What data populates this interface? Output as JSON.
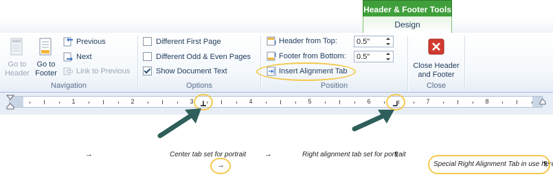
{
  "contextual_tab": {
    "title": "Header & Footer Tools",
    "tab": "Design"
  },
  "navigation": {
    "label": "Navigation",
    "go_to_header": [
      "Go to",
      "Header"
    ],
    "go_to_footer": [
      "Go to",
      "Footer"
    ],
    "previous": "Previous",
    "next": "Next",
    "link_to_previous": "Link to Previous"
  },
  "options": {
    "label": "Options",
    "different_first_page": {
      "label": "Different First Page",
      "checked": false
    },
    "different_odd_even": {
      "label": "Different Odd & Even Pages",
      "checked": false
    },
    "show_document_text": {
      "label": "Show Document Text",
      "checked": true
    }
  },
  "position": {
    "label": "Position",
    "header_from_top": {
      "label": "Header from Top:",
      "value": "0.5\""
    },
    "footer_from_bottom": {
      "label": "Footer from Bottom:",
      "value": "0.5\""
    },
    "insert_alignment_tab": "Insert Alignment Tab"
  },
  "close": {
    "label": "Close",
    "close_button": [
      "Close Header",
      "and Footer"
    ]
  },
  "ruler": {
    "numbers": [
      "1",
      "2",
      "3",
      "4",
      "5",
      "6",
      "7",
      "8"
    ]
  },
  "document": {
    "center_tab_text": "Center tab set for portrait",
    "right_tab_text": "Right alignment tab set for portrait",
    "special_text": "Special Right Alignment Tab in use here",
    "tab_glyph": "→",
    "pilcrow": "¶"
  },
  "colors": {
    "contextual_green": "#3f9f3a",
    "highlight": "#f4c84c",
    "arrow": "#2e5f5a",
    "close_red": "#d23b2f"
  }
}
